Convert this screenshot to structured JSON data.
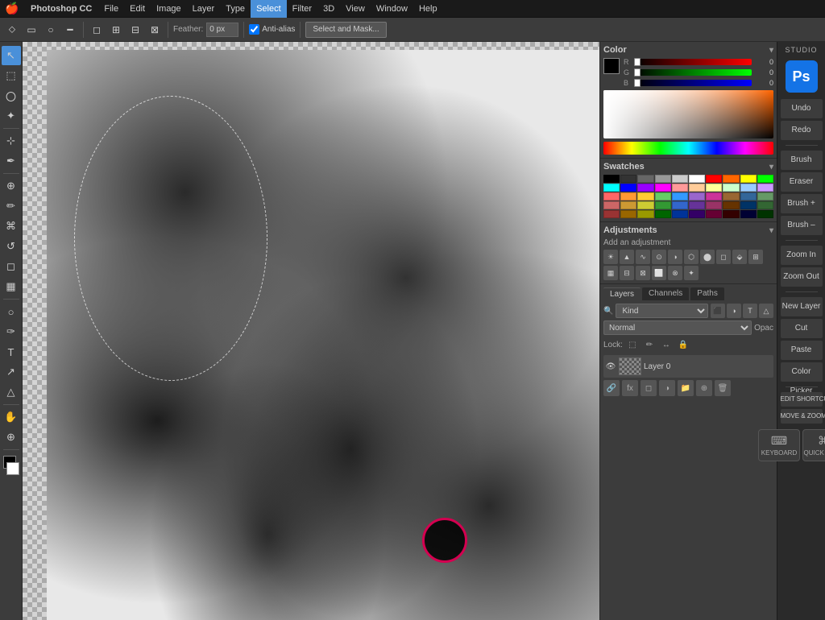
{
  "app": {
    "name": "Photoshop CC",
    "title": "STUDIO"
  },
  "menubar": {
    "apple": "⌘",
    "items": [
      "File",
      "Edit",
      "Image",
      "Layer",
      "Type",
      "Select",
      "Filter",
      "3D",
      "View",
      "Window",
      "Help"
    ]
  },
  "toolbar": {
    "feather_label": "Feather:",
    "feather_value": "0 px",
    "anti_alias_label": "Anti-alias",
    "select_mask_label": "Select and Mask..."
  },
  "left_tools": {
    "tools": [
      "▲",
      "✦",
      "○",
      "✂",
      "⊹",
      "✏",
      "⬚",
      "T",
      "↗",
      "⊕",
      "◎"
    ]
  },
  "studio": {
    "header": "STUDIO",
    "ps_label": "Ps",
    "buttons": [
      "Undo",
      "Redo",
      "Brush",
      "Eraser",
      "Brush +",
      "Brush –",
      "Zoom In",
      "Zoom Out",
      "New Layer",
      "Cut",
      "Paste",
      "Color Picker"
    ],
    "shortcuts_label": "EDIT SHORTCUTS >",
    "move_zoom_label": "MOVE & ZOOM >",
    "keyboard_label": "KEYBOARD",
    "quickkeys_label": "QUICK KEYS"
  },
  "color_panel": {
    "title": "Color",
    "r_label": "R",
    "g_label": "G",
    "b_label": "B",
    "r_value": "0",
    "g_value": "0",
    "b_value": "0",
    "r_pos": 0,
    "g_pos": 0,
    "b_pos": 0
  },
  "swatches_panel": {
    "title": "Swatches",
    "colors": [
      "#000000",
      "#333333",
      "#666666",
      "#999999",
      "#cccccc",
      "#ffffff",
      "#ff0000",
      "#ff6600",
      "#ffff00",
      "#00ff00",
      "#00ffff",
      "#0000ff",
      "#9900ff",
      "#ff00ff",
      "#ff9999",
      "#ffcc99",
      "#ffff99",
      "#ccffcc",
      "#99ccff",
      "#cc99ff",
      "#ff6666",
      "#ff9933",
      "#ffcc33",
      "#66cc66",
      "#3399ff",
      "#9966cc",
      "#cc3399",
      "#996633",
      "#336699",
      "#669966",
      "#cc6666",
      "#cc9933",
      "#cccc33",
      "#339933",
      "#3366cc",
      "#663399",
      "#993366",
      "#663300",
      "#003366",
      "#336633",
      "#993333",
      "#996600",
      "#999900",
      "#006600",
      "#003399",
      "#330066",
      "#660033",
      "#330000",
      "#000033",
      "#003300"
    ]
  },
  "adjustments_panel": {
    "title": "Adjustments",
    "subtitle": "Add an adjustment",
    "icons": [
      "☀",
      "◑",
      "◻",
      "▣",
      "⊟",
      "∿",
      "⬤",
      "⬡",
      "⬙",
      "⊞",
      "⊡",
      "⬜",
      "⬛",
      "⬜",
      "⊕",
      "⊗"
    ]
  },
  "layers_panel": {
    "title": "Layers",
    "tabs": [
      "Layers",
      "Channels",
      "Paths"
    ],
    "active_tab": "Layers",
    "filter_placeholder": "Kind",
    "blend_mode": "Normal",
    "opacity_label": "Opac",
    "layers": [
      {
        "name": "Layer 0",
        "visible": true
      }
    ]
  },
  "icons": {
    "eye": "👁",
    "lock": "🔒",
    "fx": "fx",
    "new_layer": "⊕",
    "delete": "🗑",
    "link": "🔗",
    "mask": "◻",
    "group": "📁"
  }
}
